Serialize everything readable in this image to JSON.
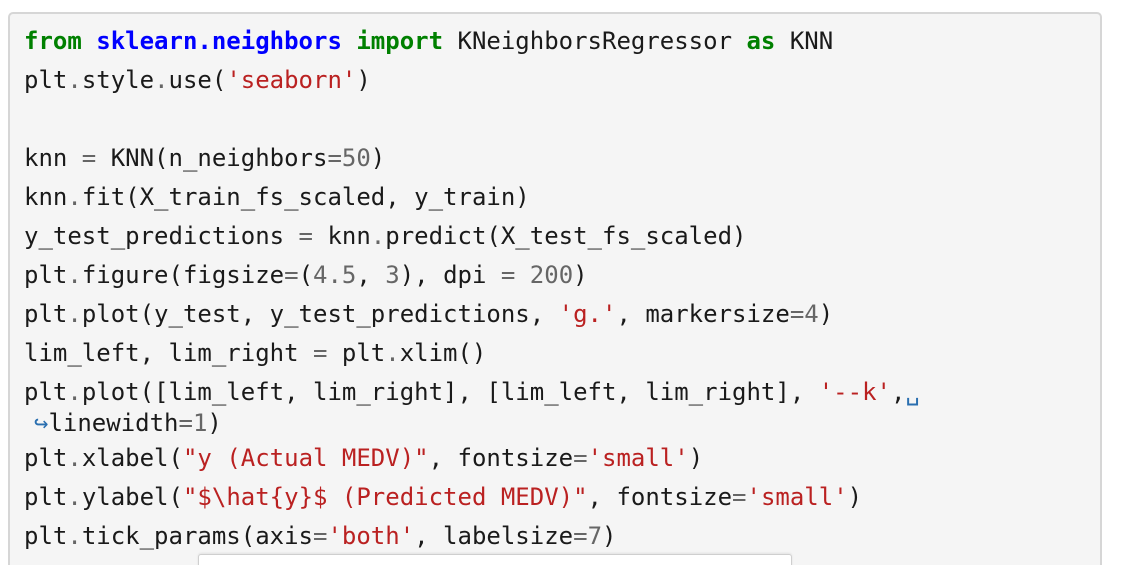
{
  "lines": [
    [
      {
        "t": "from",
        "c": "kw"
      },
      {
        "t": " "
      },
      {
        "t": "sklearn.neighbors",
        "c": "mod"
      },
      {
        "t": " "
      },
      {
        "t": "import",
        "c": "kw"
      },
      {
        "t": " KNeighborsRegressor "
      },
      {
        "t": "as",
        "c": "kw"
      },
      {
        "t": " KNN"
      }
    ],
    [
      {
        "t": "plt"
      },
      {
        "t": ".",
        "c": "op"
      },
      {
        "t": "style"
      },
      {
        "t": ".",
        "c": "op"
      },
      {
        "t": "use("
      },
      {
        "t": "'seaborn'",
        "c": "str"
      },
      {
        "t": ")"
      }
    ],
    [],
    [
      {
        "t": "knn "
      },
      {
        "t": "=",
        "c": "op"
      },
      {
        "t": " KNN(n_neighbors"
      },
      {
        "t": "=",
        "c": "op"
      },
      {
        "t": "50",
        "c": "num"
      },
      {
        "t": ")"
      }
    ],
    [
      {
        "t": "knn"
      },
      {
        "t": ".",
        "c": "op"
      },
      {
        "t": "fit(X_train_fs_scaled, y_train)"
      }
    ],
    [
      {
        "t": "y_test_predictions "
      },
      {
        "t": "=",
        "c": "op"
      },
      {
        "t": " knn"
      },
      {
        "t": ".",
        "c": "op"
      },
      {
        "t": "predict(X_test_fs_scaled)"
      }
    ],
    [
      {
        "t": "plt"
      },
      {
        "t": ".",
        "c": "op"
      },
      {
        "t": "figure(figsize"
      },
      {
        "t": "=",
        "c": "op"
      },
      {
        "t": "("
      },
      {
        "t": "4.5",
        "c": "num"
      },
      {
        "t": ", "
      },
      {
        "t": "3",
        "c": "num"
      },
      {
        "t": "), dpi "
      },
      {
        "t": "=",
        "c": "op"
      },
      {
        "t": " "
      },
      {
        "t": "200",
        "c": "num"
      },
      {
        "t": ")"
      }
    ],
    [
      {
        "t": "plt"
      },
      {
        "t": ".",
        "c": "op"
      },
      {
        "t": "plot(y_test, y_test_predictions, "
      },
      {
        "t": "'g.'",
        "c": "str"
      },
      {
        "t": ", markersize"
      },
      {
        "t": "=",
        "c": "op"
      },
      {
        "t": "4",
        "c": "num"
      },
      {
        "t": ")"
      }
    ],
    [
      {
        "t": "lim_left, lim_right "
      },
      {
        "t": "=",
        "c": "op"
      },
      {
        "t": " plt"
      },
      {
        "t": ".",
        "c": "op"
      },
      {
        "t": "xlim()"
      }
    ],
    [
      {
        "t": "plt"
      },
      {
        "t": ".",
        "c": "op"
      },
      {
        "t": "plot([lim_left, lim_right], [lim_left, lim_right], "
      },
      {
        "t": "'--k'",
        "c": "str"
      },
      {
        "t": ","
      },
      {
        "t": "␣",
        "c": "cont-mark"
      }
    ],
    {
      "cont": true,
      "tokens": [
        {
          "t": "↪",
          "c": "cont-mark"
        },
        {
          "t": "linewidth"
        },
        {
          "t": "=",
          "c": "op"
        },
        {
          "t": "1",
          "c": "num"
        },
        {
          "t": ")"
        }
      ]
    },
    [
      {
        "t": "plt"
      },
      {
        "t": ".",
        "c": "op"
      },
      {
        "t": "xlabel("
      },
      {
        "t": "\"y (Actual MEDV)\"",
        "c": "str"
      },
      {
        "t": ", fontsize"
      },
      {
        "t": "=",
        "c": "op"
      },
      {
        "t": "'small'",
        "c": "str"
      },
      {
        "t": ")"
      }
    ],
    [
      {
        "t": "plt"
      },
      {
        "t": ".",
        "c": "op"
      },
      {
        "t": "ylabel("
      },
      {
        "t": "\"$\\hat{y}$ (Predicted MEDV)\"",
        "c": "str"
      },
      {
        "t": ", fontsize"
      },
      {
        "t": "=",
        "c": "op"
      },
      {
        "t": "'small'",
        "c": "str"
      },
      {
        "t": ")"
      }
    ],
    [
      {
        "t": "plt"
      },
      {
        "t": ".",
        "c": "op"
      },
      {
        "t": "tick_params(axis"
      },
      {
        "t": "=",
        "c": "op"
      },
      {
        "t": "'both'",
        "c": "str"
      },
      {
        "t": ", labelsize"
      },
      {
        "t": "=",
        "c": "op"
      },
      {
        "t": "7",
        "c": "num"
      },
      {
        "t": ")"
      }
    ]
  ],
  "colors": {
    "keyword": "#008000",
    "module": "#0000ff",
    "string": "#ba2121",
    "number": "#666666",
    "cell_background": "#f5f5f5",
    "cell_border": "#d6d6d6"
  }
}
